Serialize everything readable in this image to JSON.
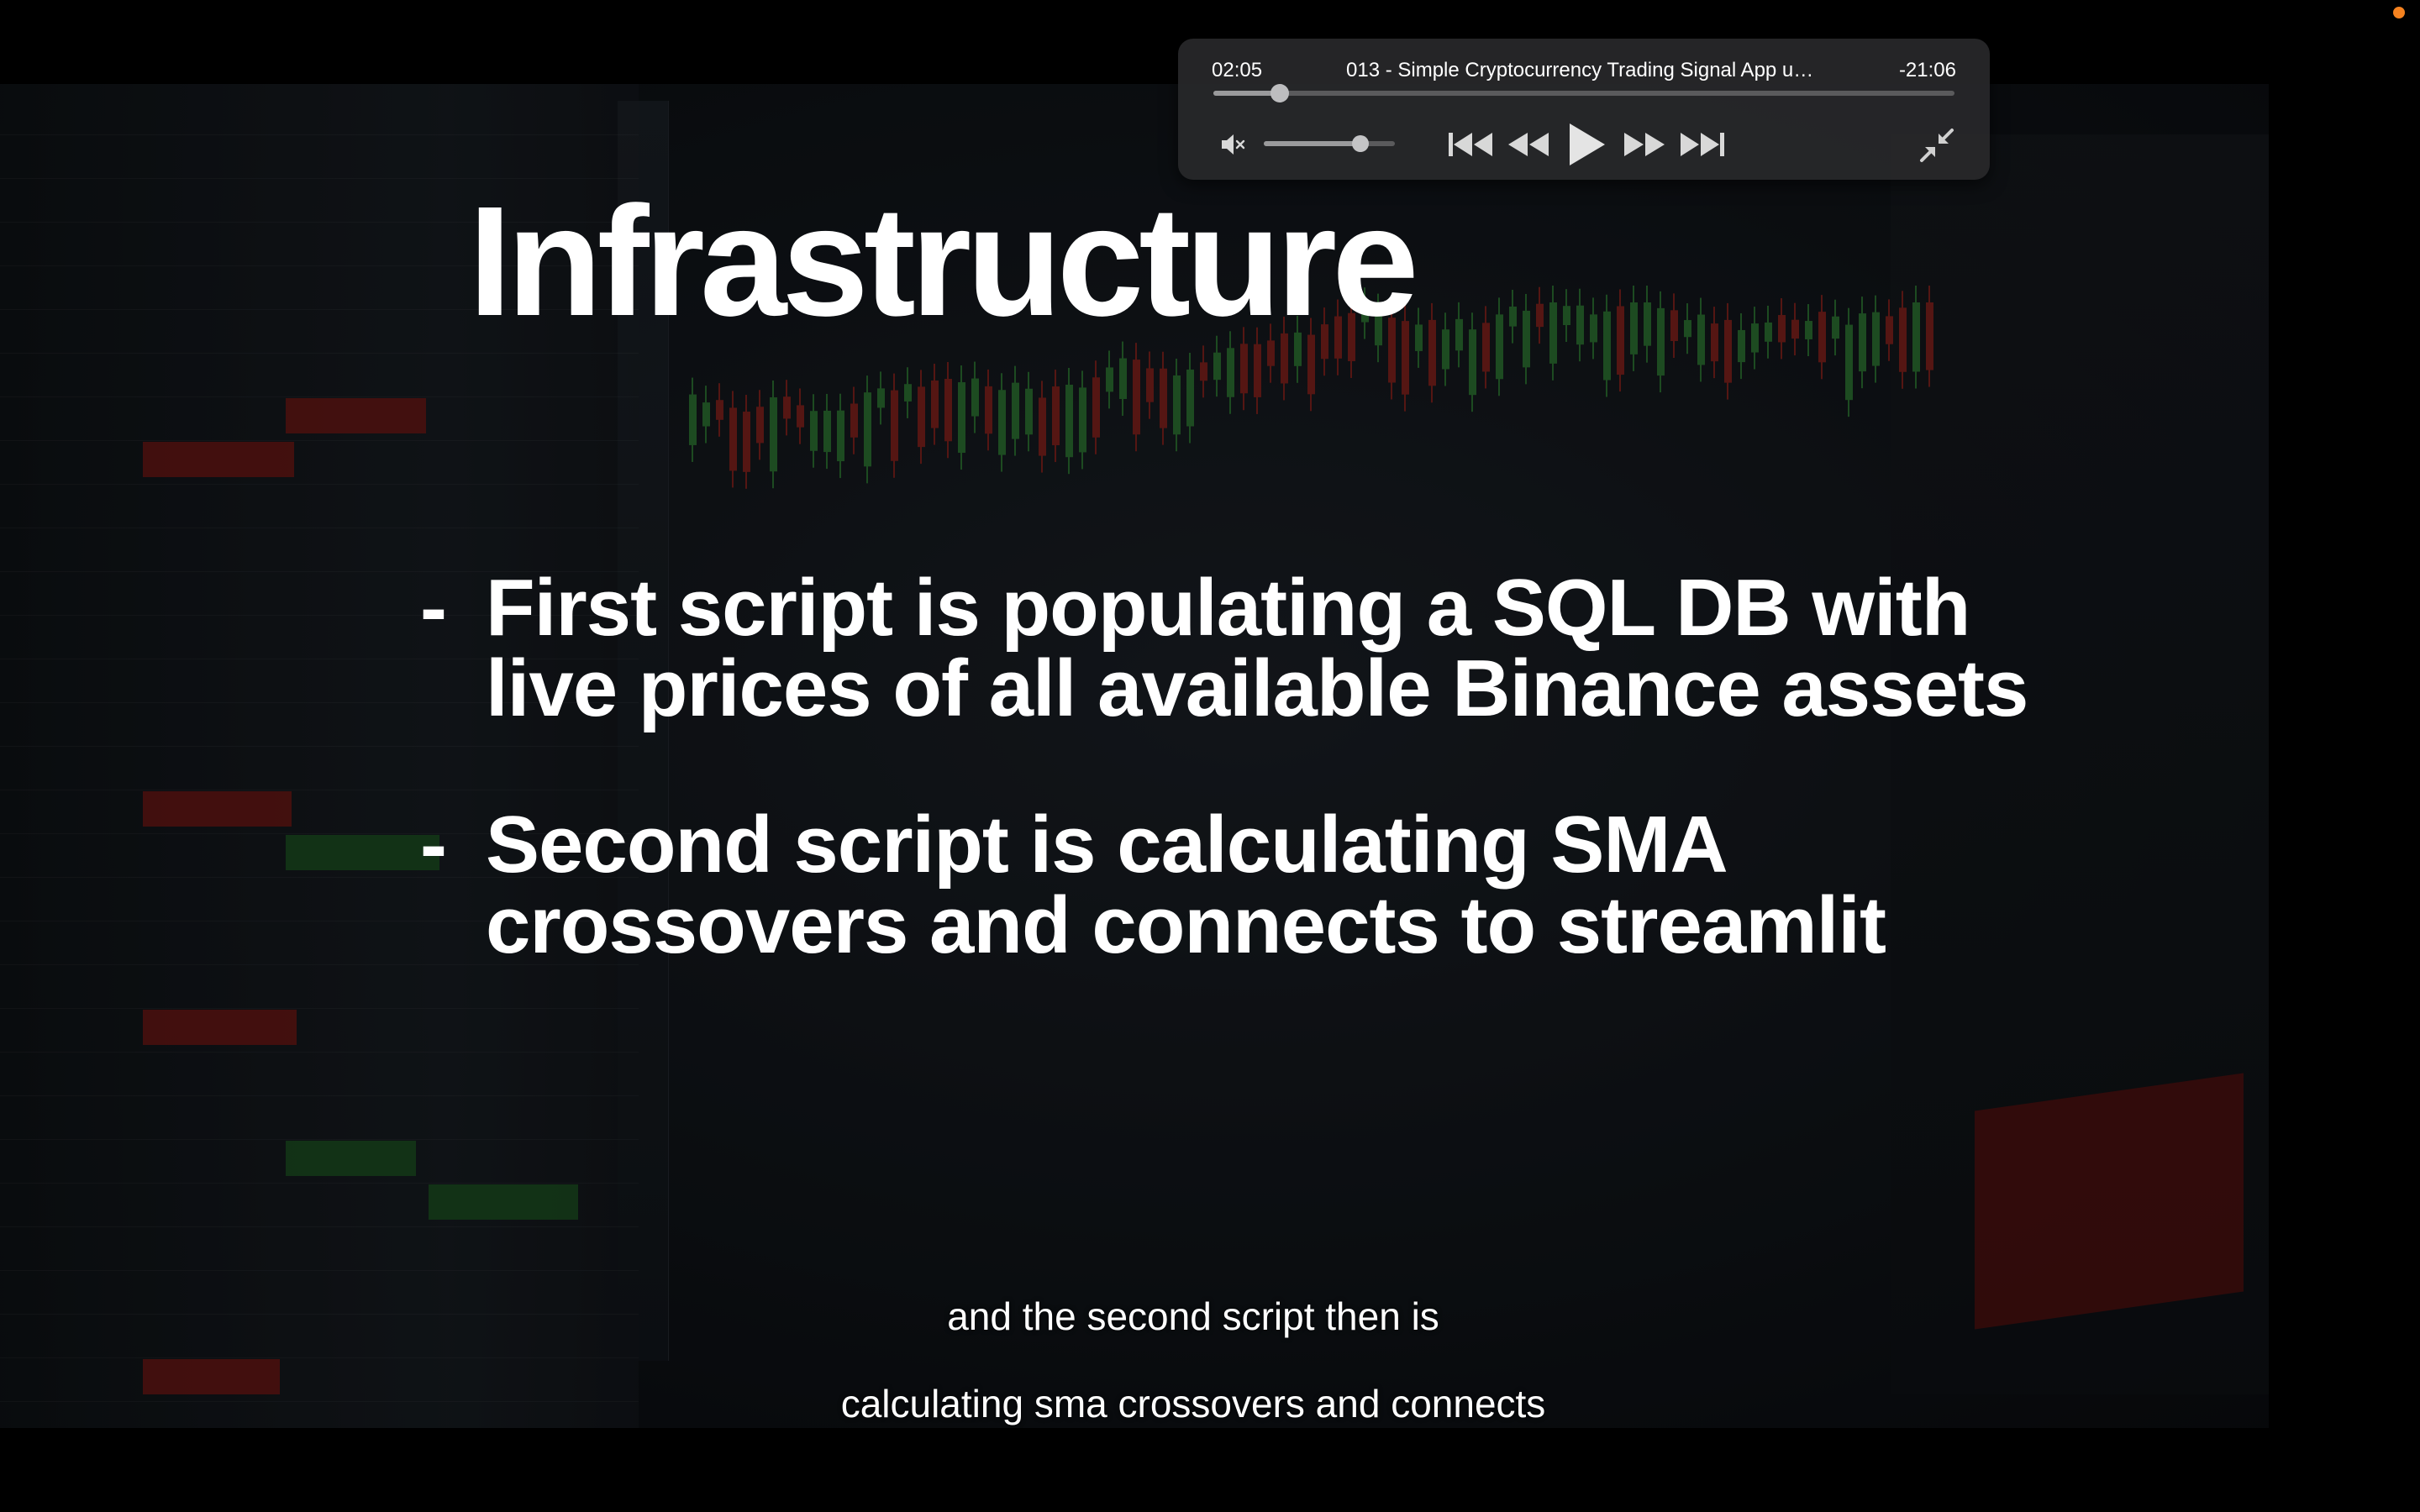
{
  "slide": {
    "title": "Infrastructure",
    "bullets": [
      {
        "dash": "-",
        "lines": [
          "First script is populating a SQL DB with",
          "live prices of all available Binance assets"
        ]
      },
      {
        "dash": "-",
        "lines": [
          "Second script is calculating SMA",
          "crossovers and connects to streamlit"
        ]
      }
    ]
  },
  "captions": [
    "and the second script then is",
    "calculating sma crossovers and connects"
  ],
  "player": {
    "elapsed": "02:05",
    "remaining": "-21:06",
    "title": "013 - Simple Cryptocurrency Trading Signal App us...",
    "progress_fraction": 0.09,
    "volume_fraction": 0.74,
    "icons": {
      "mute": "speaker-muted-icon",
      "skip_back": "skip-to-start-icon",
      "rewind": "rewind-icon",
      "play": "play-icon",
      "forward": "fast-forward-icon",
      "skip_forward": "skip-to-end-icon",
      "exit_pip": "exit-picture-in-picture-icon"
    }
  },
  "colors": {
    "accent_dot": "#f5821f",
    "hud_bg": "#28282a",
    "text": "#ffffff"
  }
}
